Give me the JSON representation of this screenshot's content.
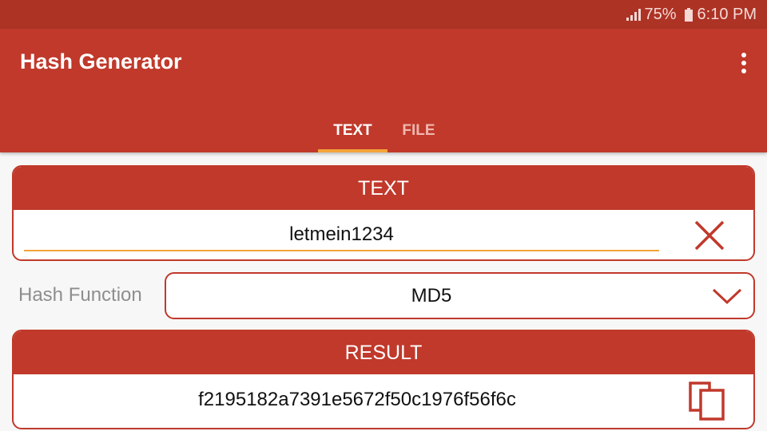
{
  "status_bar": {
    "battery_percent": "75%",
    "time": "6:10 PM",
    "icons": [
      "signal-icon",
      "battery-icon"
    ]
  },
  "app_bar": {
    "title": "Hash Generator",
    "menu_icon": "overflow-menu-icon"
  },
  "tabs": [
    {
      "label": "TEXT",
      "selected": true
    },
    {
      "label": "FILE",
      "selected": false
    }
  ],
  "text_card": {
    "header": "TEXT",
    "input_value": "letmein1234",
    "clear_icon": "close-icon"
  },
  "hash_function": {
    "label": "Hash Function",
    "selected": "MD5",
    "dropdown_icon": "chevron-down-icon"
  },
  "result_card": {
    "header": "RESULT",
    "value": "f2195182a7391e5672f50c1976f56f6c",
    "copy_icon": "copy-icon"
  },
  "colors": {
    "primary": "#c0392b",
    "status_bar": "#ad3325",
    "accent": "#f3a43a"
  }
}
